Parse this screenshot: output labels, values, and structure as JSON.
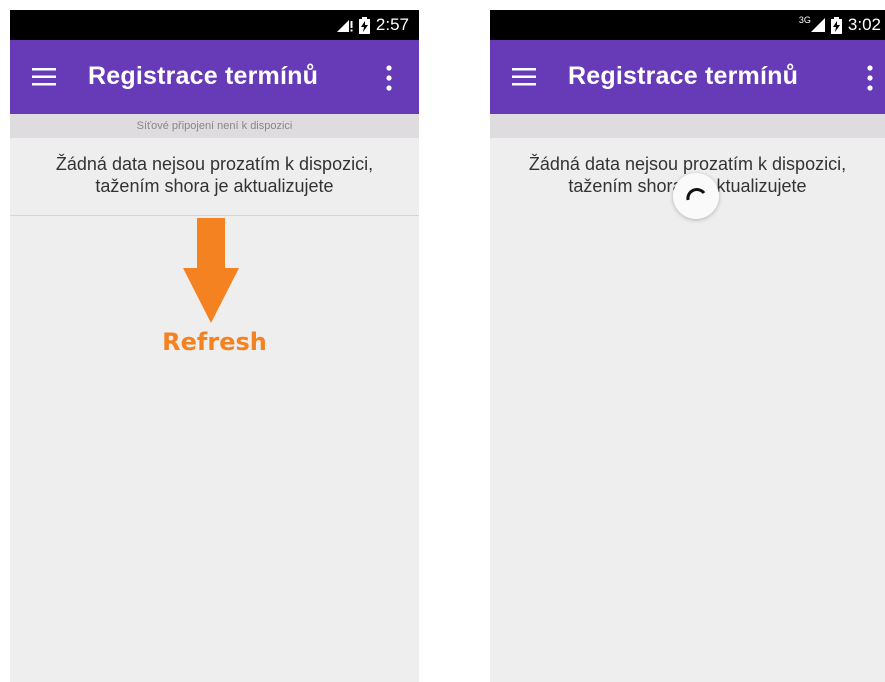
{
  "colors": {
    "app_bar": "#673ab7",
    "status_bar": "#000000",
    "background": "#eeeeee",
    "banner": "#dedcde",
    "annotation_accent": "#f58220"
  },
  "left_screen": {
    "status_bar": {
      "time": "2:57",
      "icons": [
        "signal-no-data-icon",
        "battery-charging-icon"
      ]
    },
    "app_bar": {
      "menu_icon": "hamburger-menu-icon",
      "title": "Registrace termínů",
      "overflow_icon": "more-vert-icon"
    },
    "network_banner": "Síťové připojení není k dispozici",
    "empty_message_line1": "Žádná data nejsou prozatím k dispozici,",
    "empty_message_line2": "tažením shora je aktualizujete",
    "annotation": {
      "icon": "arrow-down-icon",
      "label": "Refresh"
    }
  },
  "right_screen": {
    "status_bar": {
      "network_type": "3G",
      "time": "3:02",
      "icons": [
        "signal-icon",
        "battery-charging-icon"
      ]
    },
    "app_bar": {
      "menu_icon": "hamburger-menu-icon",
      "title": "Registrace termínů",
      "overflow_icon": "more-vert-icon"
    },
    "empty_message_line1": "Žádná data nejsou prozatím k dispozici,",
    "empty_message_line2": "tažením shora je aktualizujete",
    "refresh_indicator": "loading-spinner-icon"
  }
}
